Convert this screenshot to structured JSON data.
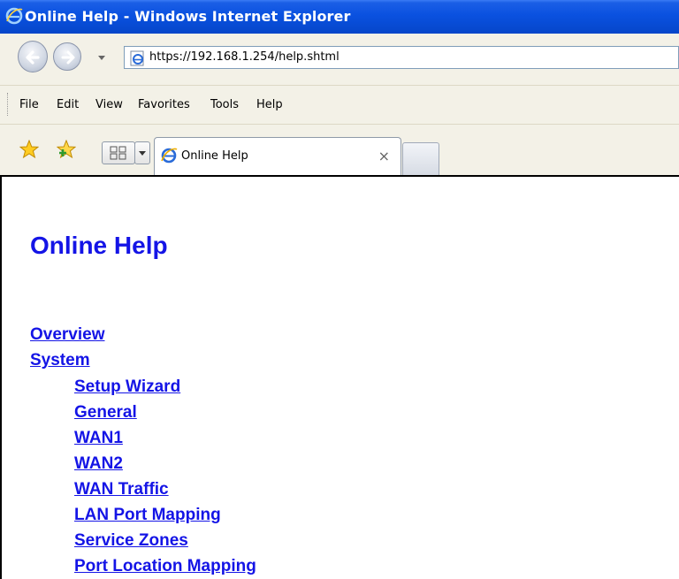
{
  "window": {
    "title": "Online Help - Windows Internet Explorer"
  },
  "address_bar": {
    "url": "https://192.168.1.254/help.shtml"
  },
  "menu": {
    "items": [
      "File",
      "Edit",
      "View",
      "Favorites",
      "Tools",
      "Help"
    ]
  },
  "tabs": {
    "active_label": "Online Help",
    "close_glyph": "×"
  },
  "page": {
    "title": "Online Help",
    "links": [
      {
        "label": "Overview",
        "level": 0
      },
      {
        "label": "System",
        "level": 0
      },
      {
        "label": "Setup Wizard",
        "level": 1
      },
      {
        "label": "General",
        "level": 1
      },
      {
        "label": "WAN1",
        "level": 1
      },
      {
        "label": "WAN2",
        "level": 1
      },
      {
        "label": "WAN Traffic",
        "level": 1
      },
      {
        "label": "LAN Port Mapping",
        "level": 1
      },
      {
        "label": "Service Zones",
        "level": 1
      },
      {
        "label": "Port Location Mapping",
        "level": 1
      }
    ]
  },
  "colors": {
    "link": "#1414e6",
    "titlebar": "#0a51e0",
    "chrome": "#f3f1e7"
  },
  "icons": {
    "browser": "ie-logo-icon",
    "back": "back-arrow-icon",
    "forward": "forward-arrow-icon",
    "favorites": "favorites-star-icon",
    "add_favorites": "add-favorites-icon",
    "quick_tabs": "quick-tabs-icon"
  }
}
